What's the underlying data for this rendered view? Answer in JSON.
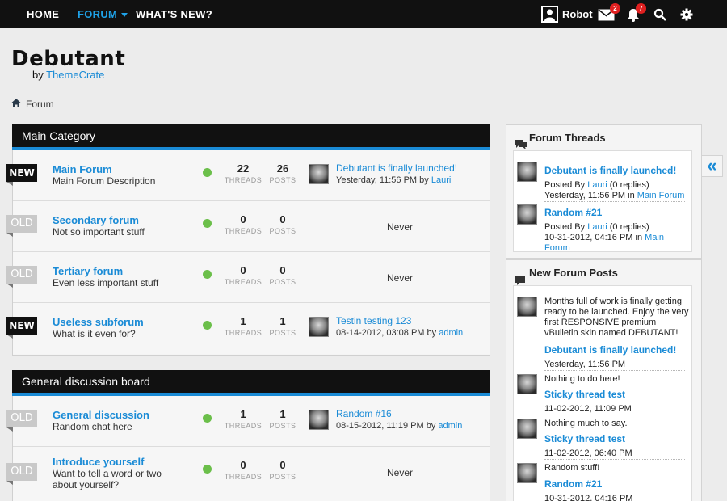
{
  "nav": {
    "home": "HOME",
    "forum": "FORUM",
    "whats_new": "WHAT'S NEW?",
    "username": "Robot",
    "messages_count": "2",
    "notifications_count": "7"
  },
  "logo": {
    "name": "Debutant",
    "by": "by",
    "brand": "ThemeCrate"
  },
  "breadcrumb": "Forum",
  "categories": [
    {
      "title": "Main Category",
      "forums": [
        {
          "tag": "NEW",
          "title": "Main Forum",
          "desc": "Main Forum Description",
          "threads": "22",
          "posts": "26",
          "last_title": "Debutant is finally launched!",
          "last_date": "Yesterday, 11:56 PM",
          "last_by": "by",
          "last_user": "Lauri"
        },
        {
          "tag": "OLD",
          "title": "Secondary forum",
          "desc": "Not so important stuff",
          "threads": "0",
          "posts": "0",
          "never": "Never"
        },
        {
          "tag": "OLD",
          "title": "Tertiary forum",
          "desc": "Even less important stuff",
          "threads": "0",
          "posts": "0",
          "never": "Never"
        },
        {
          "tag": "NEW",
          "title": "Useless subforum",
          "desc": "What is it even for?",
          "threads": "1",
          "posts": "1",
          "last_title": "Testin testing 123",
          "last_date": "08-14-2012, 03:08 PM",
          "last_by": "by",
          "last_user": "admin"
        }
      ]
    },
    {
      "title": "General discussion board",
      "forums": [
        {
          "tag": "OLD",
          "title": "General discussion",
          "desc": "Random chat here",
          "threads": "1",
          "posts": "1",
          "last_title": "Random #16",
          "last_date": "08-15-2012, 11:19 PM",
          "last_by": "by",
          "last_user": "admin"
        },
        {
          "tag": "OLD",
          "title": "Introduce yourself",
          "desc": "Want to tell a word or two",
          "desc2": "about yourself?",
          "threads": "0",
          "posts": "0",
          "never": "Never"
        }
      ]
    }
  ],
  "labels": {
    "threads": "THREADS",
    "posts": "POSTS"
  },
  "sidebar": {
    "threads_title": "Forum Threads",
    "threads": [
      {
        "title": "Debutant is finally launched!",
        "posted_by": "Posted By",
        "user": "Lauri",
        "replies": "(0 replies)",
        "date": "Yesterday, 11:56 PM",
        "in": "in",
        "forum": "Main Forum"
      },
      {
        "title": "Random #21",
        "posted_by": "Posted By",
        "user": "Lauri",
        "replies": "(0 replies)",
        "date": "10-31-2012, 04:16 PM",
        "in": "in",
        "forum": "Main Forum"
      }
    ],
    "posts_title": "New Forum Posts",
    "posts": [
      {
        "text": "Months full of work is finally getting ready to be launched. Enjoy the very first RESPONSIVE premium vBulletin skin named DEBUTANT!",
        "title": "Debutant is finally launched!",
        "date": "Yesterday, 11:56 PM"
      },
      {
        "text": "Nothing to do here!",
        "title": "Sticky thread test",
        "date": "11-02-2012, 11:09 PM"
      },
      {
        "text": "Nothing much to say.",
        "title": "Sticky thread test",
        "date": "11-02-2012, 06:40 PM"
      },
      {
        "text": "Random stuff!",
        "title": "Random #21",
        "date": "10-31-2012, 04:16 PM"
      }
    ]
  },
  "colors": {
    "accent": "#1a8bd6",
    "topbar": "#111111",
    "badge": "#e02020",
    "online": "#6bbf4a"
  },
  "icons": {
    "collapse": "«"
  }
}
